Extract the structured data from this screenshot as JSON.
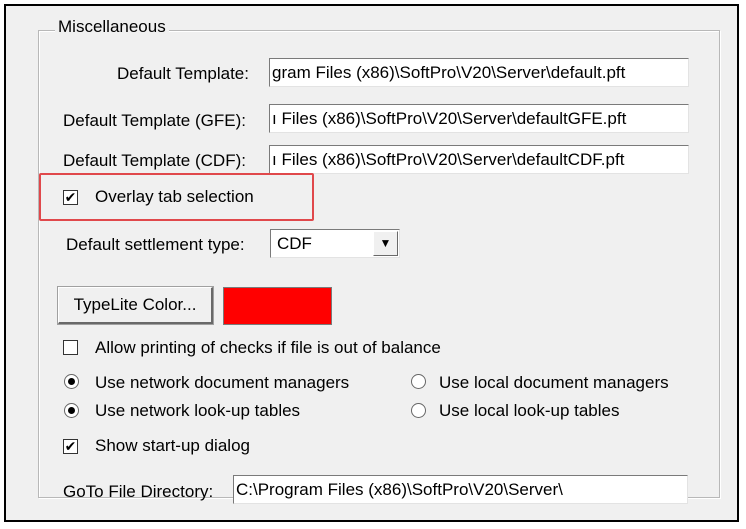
{
  "group": {
    "title": "Miscellaneous"
  },
  "templates": {
    "default_label": "Default Template:",
    "default_value": "gram Files (x86)\\SoftPro\\V20\\Server\\default.pft",
    "gfe_label": "Default Template (GFE):",
    "gfe_value": "ı Files (x86)\\SoftPro\\V20\\Server\\defaultGFE.pft",
    "cdf_label": "Default Template (CDF):",
    "cdf_value": "ı Files (x86)\\SoftPro\\V20\\Server\\defaultCDF.pft"
  },
  "overlay": {
    "label": "Overlay tab selection",
    "checked": true
  },
  "settlement": {
    "label": "Default settlement type:",
    "value": "CDF"
  },
  "typelite": {
    "button_label": "TypeLite Color...",
    "color": "#ff0000"
  },
  "options": {
    "allow_printing_label": "Allow printing of checks if file is out of balance",
    "allow_printing_checked": false,
    "doc_network_label": "Use network document managers",
    "doc_local_label": "Use local document managers",
    "lookup_network_label": "Use network look-up tables",
    "lookup_local_label": "Use local look-up tables",
    "startup_label": "Show start-up dialog",
    "startup_checked": true
  },
  "goto": {
    "label": "GoTo File Directory:",
    "value": "C:\\Program Files (x86)\\SoftPro\\V20\\Server\\"
  },
  "colors": {
    "highlight": "#e0484b",
    "dialog_bg": "#f0f0f0"
  }
}
